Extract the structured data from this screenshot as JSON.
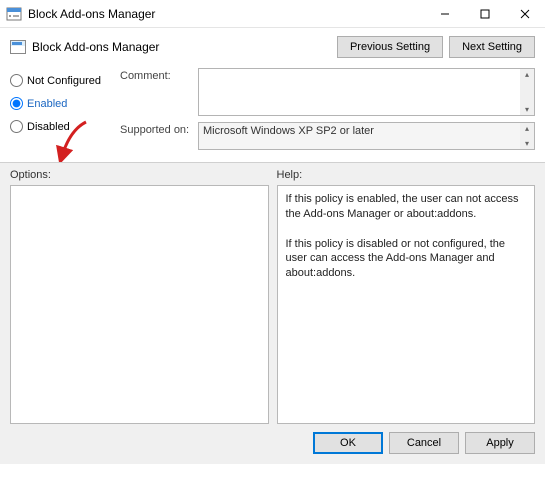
{
  "window": {
    "title": "Block Add-ons Manager"
  },
  "policy": {
    "title": "Block Add-ons Manager"
  },
  "nav": {
    "prev": "Previous Setting",
    "next": "Next Setting"
  },
  "radio": {
    "not_configured": "Not Configured",
    "enabled": "Enabled",
    "disabled": "Disabled",
    "selected": "enabled"
  },
  "labels": {
    "comment": "Comment:",
    "supported": "Supported on:",
    "options": "Options:",
    "help": "Help:"
  },
  "fields": {
    "comment_value": "",
    "supported_value": "Microsoft Windows XP SP2 or later"
  },
  "help_text": {
    "p1": "If this policy is enabled, the user can not access the Add-ons Manager or about:addons.",
    "p2": "If this policy is disabled or not configured, the user can access the Add-ons Manager and about:addons."
  },
  "buttons": {
    "ok": "OK",
    "cancel": "Cancel",
    "apply": "Apply"
  }
}
